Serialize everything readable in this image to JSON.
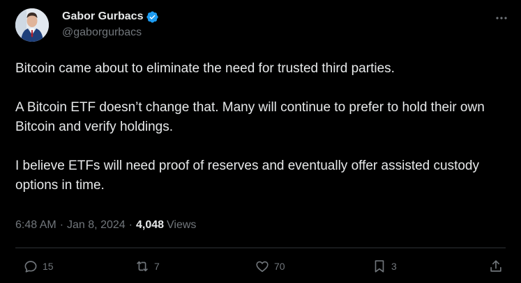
{
  "author": {
    "display_name": "Gabor Gurbacs",
    "handle": "@gaborgurbacs",
    "verified": true
  },
  "tweet": {
    "paragraphs": [
      "Bitcoin came about to eliminate the need for trusted third parties.",
      "A Bitcoin ETF doesn’t change that. Many will continue to prefer to hold their own Bitcoin and verify holdings.",
      "I believe ETFs will need proof of reserves and eventually offer assisted custody options in time."
    ]
  },
  "meta": {
    "time": "6:48 AM",
    "date": "Jan 8, 2024",
    "views_count": "4,048",
    "views_label": "Views",
    "separator": "·"
  },
  "actions": {
    "replies": "15",
    "reposts": "7",
    "likes": "70",
    "bookmarks": "3"
  },
  "icons": [
    "more-icon",
    "verified-badge-icon",
    "reply-icon",
    "repost-icon",
    "like-icon",
    "bookmark-icon",
    "share-icon"
  ],
  "colors": {
    "background": "#000000",
    "text_primary": "#e7e9ea",
    "text_secondary": "#71767b",
    "verified": "#1d9bf0",
    "divider": "#2f3336"
  }
}
